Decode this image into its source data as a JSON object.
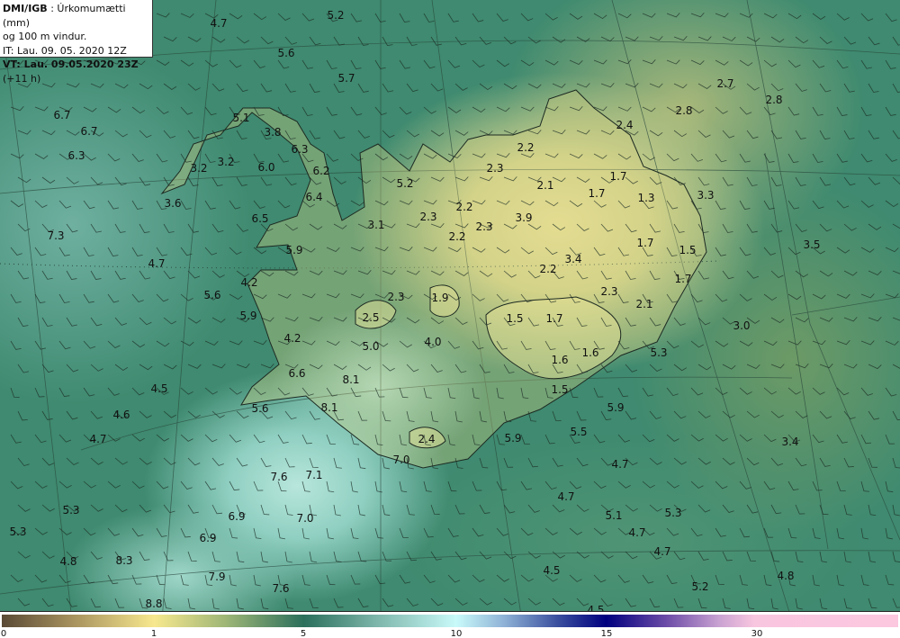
{
  "header": {
    "source": "DMI/IGB",
    "product": ": Úrkomumætti (mm)",
    "product_line2": "og 100 m vindur.",
    "initial_time": "IT: Lau. 09. 05. 2020 12Z",
    "valid_time": "VT: Lau. 09.05.2020 23Z",
    "lead_time": "(+11 h)"
  },
  "colorbar": {
    "ticks": [
      "0",
      "1",
      "5",
      "10",
      "15",
      "30"
    ],
    "colors": [
      "#5a4a36",
      "#f7e88e",
      "#2b6f5c",
      "#c9fafa",
      "#00007f",
      "#f9c6df"
    ]
  },
  "precip_values": [
    "4.7",
    "5.2",
    "5.6",
    "5.7",
    "6.7",
    "6.7",
    "6.3",
    "5.1",
    "3.8",
    "6.3",
    "3.2",
    "3.2",
    "6.0",
    "6.2",
    "6.4",
    "5.2",
    "3.6",
    "6.5",
    "3.1",
    "2.3",
    "2.2",
    "2.3",
    "2.2",
    "3.9",
    "2.3",
    "2.2",
    "2.1",
    "2.4",
    "2.8",
    "2.7",
    "2.8",
    "1.7",
    "1.7",
    "1.3",
    "3.3",
    "7.3",
    "5.9",
    "1.7",
    "1.5",
    "3.5",
    "4.7",
    "3.4",
    "2.2",
    "4.2",
    "1.7",
    "5.6",
    "2.3",
    "1.9",
    "2.3",
    "2.1",
    "5.9",
    "2.5",
    "1.5",
    "1.7",
    "3.0",
    "4.2",
    "5.0",
    "4.0",
    "1.6",
    "5.3",
    "1.6",
    "6.6",
    "8.1",
    "4.5",
    "1.5",
    "5.6",
    "8.1",
    "4.6",
    "5.9",
    "5.5",
    "4.7",
    "2.4",
    "5.9",
    "3.4",
    "7.0",
    "4.7",
    "7.6",
    "7.1",
    "4.7",
    "5.3",
    "6.9",
    "7.0",
    "5.1",
    "5.3",
    "5.3",
    "6.9",
    "4.7",
    "4.8",
    "8.3",
    "4.7",
    "4.5",
    "7.9",
    "4.8",
    "7.6",
    "5.2",
    "8.8",
    "4.5"
  ]
}
